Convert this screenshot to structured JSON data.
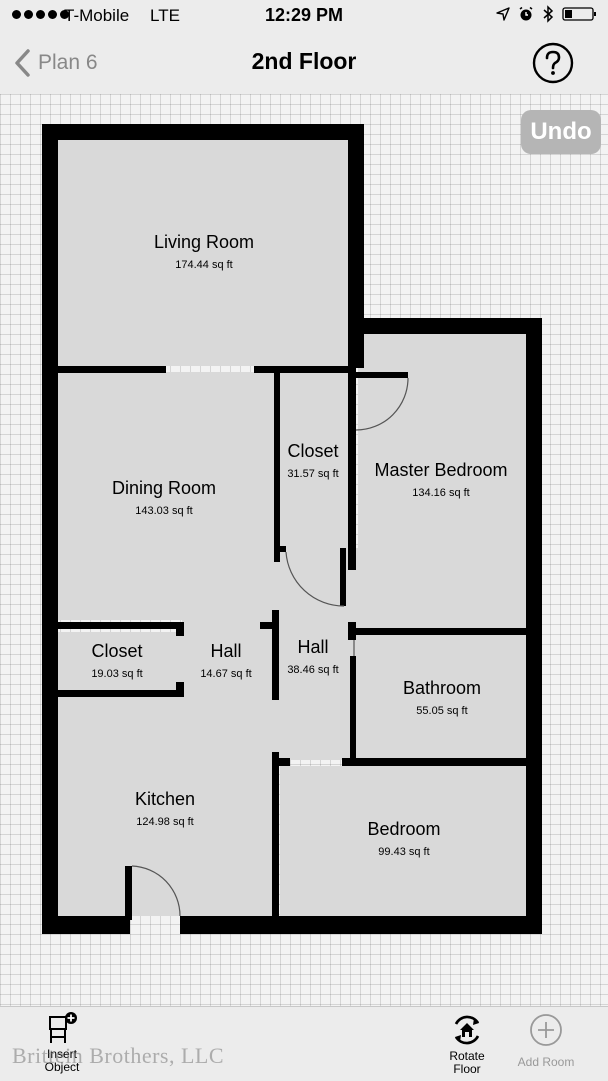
{
  "status_bar": {
    "carrier": "T-Mobile",
    "network": "LTE",
    "time": "12:29 PM",
    "icons": [
      "location-arrow-icon",
      "alarm-clock-icon",
      "bluetooth-icon",
      "battery-icon"
    ]
  },
  "nav": {
    "back_label": "Plan 6",
    "title": "2nd Floor",
    "help_icon": "question-mark-icon"
  },
  "canvas": {
    "undo_label": "Undo",
    "rooms": {
      "living_room": {
        "name": "Living Room",
        "area": "174.44 sq ft"
      },
      "dining_room": {
        "name": "Dining Room",
        "area": "143.03 sq ft"
      },
      "closet_center": {
        "name": "Closet",
        "area": "31.57 sq ft"
      },
      "master_bedroom": {
        "name": "Master Bedroom",
        "area": "134.16 sq ft"
      },
      "closet_left": {
        "name": "Closet",
        "area": "19.03 sq ft"
      },
      "hall_left": {
        "name": "Hall",
        "area": "14.67 sq ft"
      },
      "hall_center": {
        "name": "Hall",
        "area": "38.46 sq ft"
      },
      "bathroom": {
        "name": "Bathroom",
        "area": "55.05 sq ft"
      },
      "kitchen": {
        "name": "Kitchen",
        "area": "124.98 sq ft"
      },
      "bedroom": {
        "name": "Bedroom",
        "area": "99.43 sq ft"
      }
    }
  },
  "toolbar": {
    "insert_line1": "Insert",
    "insert_line2": "Object",
    "rotate_line1": "Rotate",
    "rotate_line2": "Floor",
    "add_room": "Add Room",
    "watermark": "Brittein Brothers, LLC"
  },
  "colors": {
    "room_fill": "#d9d9d9",
    "wall": "#000000",
    "grid_bg": "#f3f3f3",
    "undo_bg": "#b5b5b5",
    "disabled_text": "#999999"
  }
}
